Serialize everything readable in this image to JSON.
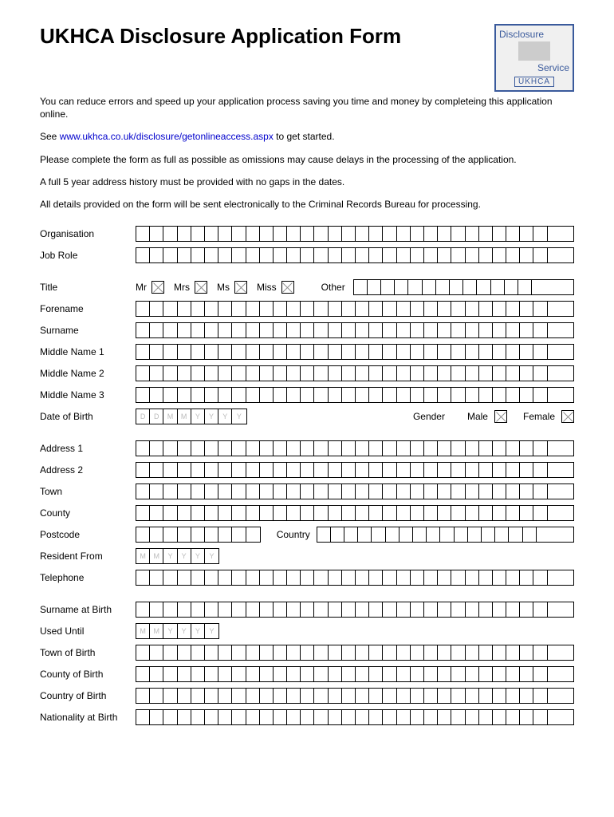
{
  "header": {
    "title": "UKHCA Disclosure Application Form",
    "logo": {
      "word1": "Disclosure",
      "word2": "Service",
      "org": "UKHCA"
    }
  },
  "intro": {
    "p1": "You can reduce errors and speed up your application process saving you time and money by completeing this application online.",
    "p2a": "See ",
    "p2link": "www.ukhca.co.uk/disclosure/getonlineaccess.aspx",
    "p2b": " to get started.",
    "p3": "Please complete the form as full as possible as omissions may cause delays in the processing of the application.",
    "p4": "A full 5 year address history must be provided with no gaps in the dates.",
    "p5": "All details provided on the form will be sent electronically to the Criminal Records Bureau for processing."
  },
  "section1": {
    "organisation": "Organisation",
    "job_role": "Job Role"
  },
  "section2": {
    "title": "Title",
    "mr": "Mr",
    "mrs": "Mrs",
    "ms": "Ms",
    "miss": "Miss",
    "other": "Other",
    "forename": "Forename",
    "surname": "Surname",
    "middle1": "Middle Name 1",
    "middle2": "Middle Name 2",
    "middle3": "Middle Name 3",
    "dob": "Date of Birth",
    "dob_hint": [
      "D",
      "D",
      "M",
      "M",
      "Y",
      "Y",
      "Y",
      "Y"
    ],
    "gender": "Gender",
    "male": "Male",
    "female": "Female"
  },
  "section3": {
    "address1": "Address 1",
    "address2": "Address 2",
    "town": "Town",
    "county": "County",
    "postcode": "Postcode",
    "country": "Country",
    "resident_from": "Resident From",
    "resfrom_hint": [
      "M",
      "M",
      "Y",
      "Y",
      "Y",
      "Y"
    ],
    "telephone": "Telephone"
  },
  "section4": {
    "surname_birth": "Surname at Birth",
    "used_until": "Used Until",
    "used_hint": [
      "M",
      "M",
      "Y",
      "Y",
      "Y",
      "Y"
    ],
    "town_birth": "Town of Birth",
    "county_birth": "County of Birth",
    "country_birth": "Country of Birth",
    "nationality": "Nationality at Birth"
  }
}
